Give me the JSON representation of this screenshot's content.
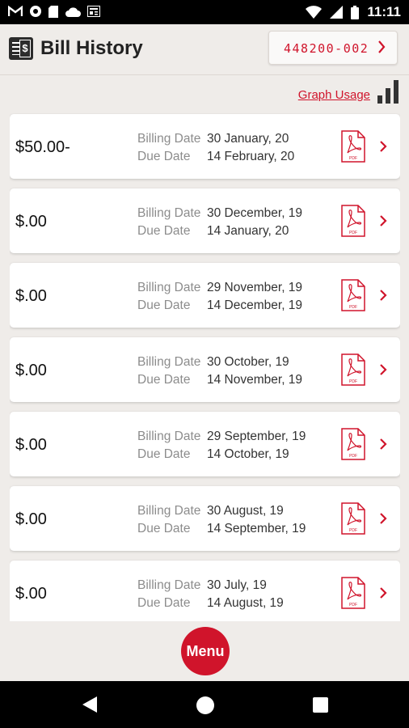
{
  "status_bar": {
    "time": "11:11",
    "left_icons": [
      "gmail-icon",
      "circle-icon",
      "sd-card-icon",
      "cloud-icon",
      "news-icon"
    ],
    "right_icons": [
      "wifi-icon",
      "signal-icon",
      "battery-icon"
    ]
  },
  "header": {
    "title": "Bill History",
    "account_number": "448200-002"
  },
  "toolbar": {
    "graph_usage_label": "Graph Usage"
  },
  "labels": {
    "billing_date": "Billing Date",
    "due_date": "Due Date"
  },
  "bills": [
    {
      "amount": "$50.00-",
      "billing_date": "30 January, 20",
      "due_date": "14 February, 20"
    },
    {
      "amount": "$.00",
      "billing_date": "30 December, 19",
      "due_date": "14 January, 20"
    },
    {
      "amount": "$.00",
      "billing_date": "29 November, 19",
      "due_date": "14 December, 19"
    },
    {
      "amount": "$.00",
      "billing_date": "30 October, 19",
      "due_date": "14 November, 19"
    },
    {
      "amount": "$.00",
      "billing_date": "29 September, 19",
      "due_date": "14 October, 19"
    },
    {
      "amount": "$.00",
      "billing_date": "30 August, 19",
      "due_date": "14 September, 19"
    },
    {
      "amount": "$.00",
      "billing_date": "30 July, 19",
      "due_date": "14 August, 19"
    }
  ],
  "pdf_icon_text": "PDF",
  "menu": {
    "label": "Menu"
  },
  "colors": {
    "accent": "#d0142b",
    "background": "#efece9",
    "card": "#ffffff"
  }
}
